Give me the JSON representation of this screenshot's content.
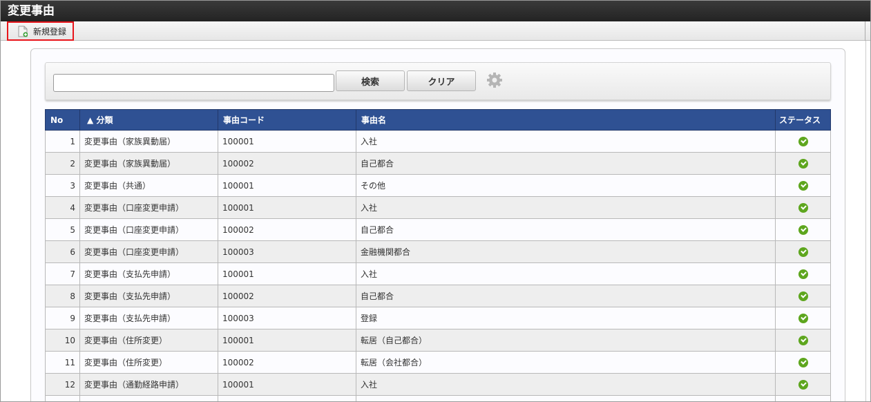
{
  "title": "変更事由",
  "toolbar": {
    "new_label": "新規登録"
  },
  "search": {
    "value": "",
    "placeholder": "",
    "search_label": "検索",
    "clear_label": "クリア"
  },
  "table": {
    "headers": {
      "no": "No",
      "category": "▲ 分類",
      "code": "事由コード",
      "name": "事由名",
      "status": "ステータス"
    },
    "rows": [
      {
        "no": "1",
        "category": "変更事由（家族異動届）",
        "code": "100001",
        "name": "入社",
        "status": "active"
      },
      {
        "no": "2",
        "category": "変更事由（家族異動届）",
        "code": "100002",
        "name": "自己都合",
        "status": "active"
      },
      {
        "no": "3",
        "category": "変更事由（共通）",
        "code": "100001",
        "name": "その他",
        "status": "active"
      },
      {
        "no": "4",
        "category": "変更事由（口座変更申請）",
        "code": "100001",
        "name": "入社",
        "status": "active"
      },
      {
        "no": "5",
        "category": "変更事由（口座変更申請）",
        "code": "100002",
        "name": "自己都合",
        "status": "active"
      },
      {
        "no": "6",
        "category": "変更事由（口座変更申請）",
        "code": "100003",
        "name": "金融機関都合",
        "status": "active"
      },
      {
        "no": "7",
        "category": "変更事由（支払先申請）",
        "code": "100001",
        "name": "入社",
        "status": "active"
      },
      {
        "no": "8",
        "category": "変更事由（支払先申請）",
        "code": "100002",
        "name": "自己都合",
        "status": "active"
      },
      {
        "no": "9",
        "category": "変更事由（支払先申請）",
        "code": "100003",
        "name": "登録",
        "status": "active"
      },
      {
        "no": "10",
        "category": "変更事由（住所変更）",
        "code": "100001",
        "name": "転居（自己都合）",
        "status": "active"
      },
      {
        "no": "11",
        "category": "変更事由（住所変更）",
        "code": "100002",
        "name": "転居（会社都合）",
        "status": "active"
      },
      {
        "no": "12",
        "category": "変更事由（通勤経路申請）",
        "code": "100001",
        "name": "入社",
        "status": "active"
      }
    ]
  },
  "colors": {
    "header": "#2f5193",
    "status_ok": "#5ea61e",
    "highlight": "#e8151b"
  }
}
